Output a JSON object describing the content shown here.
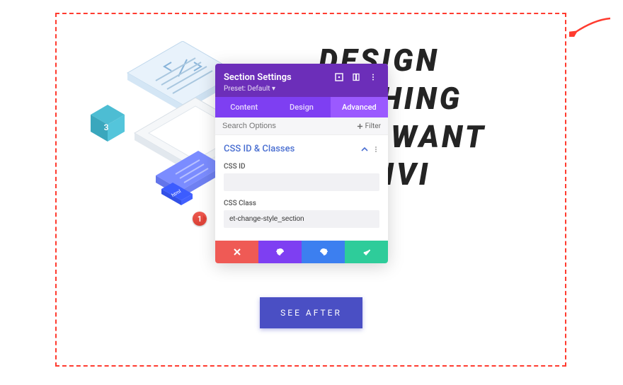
{
  "hero": {
    "line1": "DESIGN",
    "line2": "THING",
    "line3": "WANT",
    "line4": "H DIVI"
  },
  "modal": {
    "title": "Section Settings",
    "preset": "Preset: Default ▾",
    "tabs": {
      "content": "Content",
      "design": "Design",
      "advanced": "Advanced"
    },
    "search_placeholder": "Search Options",
    "filter_label": "Filter",
    "section_title": "CSS ID & Classes",
    "css_id_label": "CSS ID",
    "css_id_value": "",
    "css_class_label": "CSS Class",
    "css_class_value": "et-change-style_section"
  },
  "callout": {
    "number": "1"
  },
  "cta": {
    "label": "SEE AFTER"
  },
  "iso": {
    "cube_label": "3",
    "tag_label": "html"
  }
}
